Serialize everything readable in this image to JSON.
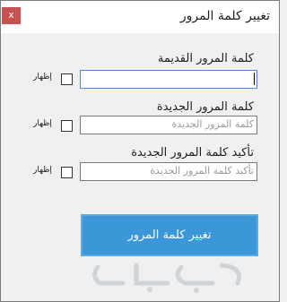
{
  "window": {
    "title": "تغيير كلمة المرور",
    "close_glyph": "x"
  },
  "fields": [
    {
      "label": "كلمة المرور القديمة",
      "placeholder": "",
      "show_label": "إظهار",
      "show_checked": false
    },
    {
      "label": "كلمة المرور الجديدة",
      "placeholder": "كلمة المرور الجديدة",
      "show_label": "إظهار",
      "show_checked": false
    },
    {
      "label": "تأكيد كلمة المرور الجديدة",
      "placeholder": "تأكيد كلمة المرور الجديدة",
      "show_label": "إظهار",
      "show_checked": false
    }
  ],
  "submit": {
    "label": "تغيير كلمة المرور"
  },
  "colors": {
    "accent": "#3b97d8",
    "close": "#c75050"
  }
}
